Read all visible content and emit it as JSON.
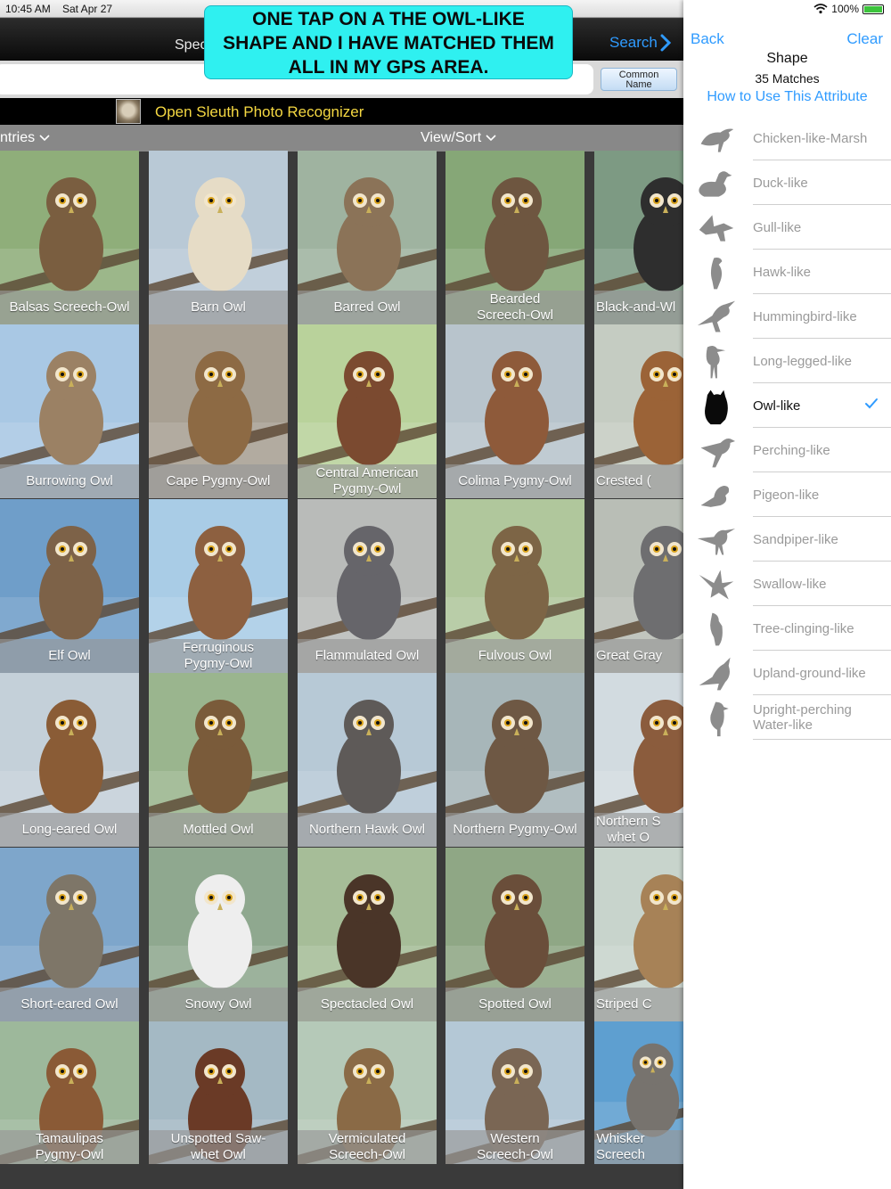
{
  "status": {
    "time": "10:45 AM",
    "date": "Sat Apr 27",
    "battery": "100%",
    "battery_level": 1.0
  },
  "nav": {
    "spec_partial": "Spec",
    "search_label": "Search"
  },
  "callout": {
    "line1": "ONE TAP ON A THE OWL-LIKE",
    "line2": "SHAPE AND I HAVE MATCHED THEM",
    "line3": "ALL IN MY GPS AREA."
  },
  "search": {
    "value": "",
    "placeholder": ""
  },
  "common_name_button": {
    "line1": "Common",
    "line2": "Name"
  },
  "sleuth": {
    "label": "Open Sleuth Photo Recognizer"
  },
  "filter": {
    "entries_label": "ntries",
    "viewsort_label": "View/Sort"
  },
  "owls": [
    {
      "name": "Balsas Screech-Owl",
      "bg": "#8fae7a",
      "body": "#7a5e40"
    },
    {
      "name": "Barn Owl",
      "bg": "#b9c9d6",
      "body": "#e6dcc6"
    },
    {
      "name": "Barred Owl",
      "bg": "#9fb3a0",
      "body": "#8b7358"
    },
    {
      "name": "Bearded\nScreech-Owl",
      "bg": "#86a777",
      "body": "#6e5640"
    },
    {
      "name": "Black-and-Wl",
      "bg": "#7d9a83",
      "body": "#2e2e2e"
    },
    {
      "name": "Burrowing Owl",
      "bg": "#a9c8e4",
      "body": "#9b8164"
    },
    {
      "name": "Cape Pygmy-Owl",
      "bg": "#a8a093",
      "body": "#8d6a44"
    },
    {
      "name": "Central American\nPygmy-Owl",
      "bg": "#b9d29b",
      "body": "#7b4a30"
    },
    {
      "name": "Colima Pygmy-Owl",
      "bg": "#b8c4cc",
      "body": "#8e5a3a"
    },
    {
      "name": "Crested (",
      "bg": "#c5ccc2",
      "body": "#9b6337"
    },
    {
      "name": "Elf Owl",
      "bg": "#6f9ec9",
      "body": "#7d6248"
    },
    {
      "name": "Ferruginous\nPygmy-Owl",
      "bg": "#a9cce6",
      "body": "#8d6040"
    },
    {
      "name": "Flammulated Owl",
      "bg": "#b9bbb9",
      "body": "#66656a"
    },
    {
      "name": "Fulvous Owl",
      "bg": "#b0c79c",
      "body": "#7d6546"
    },
    {
      "name": "Great Gray",
      "bg": "#b9beb6",
      "body": "#6e6e70"
    },
    {
      "name": "Long-eared Owl",
      "bg": "#c4d0d9",
      "body": "#8a5c36"
    },
    {
      "name": "Mottled Owl",
      "bg": "#9ab58e",
      "body": "#7a5b3a"
    },
    {
      "name": "Northern Hawk Owl",
      "bg": "#b7c9d6",
      "body": "#5e5a58"
    },
    {
      "name": "Northern Pygmy-Owl",
      "bg": "#a7b6b9",
      "body": "#6e5844"
    },
    {
      "name": "Northern S\nwhet O",
      "bg": "#d2dbe0",
      "body": "#8b5c3d"
    },
    {
      "name": "Short-eared Owl",
      "bg": "#7ea6cb",
      "body": "#7e7668"
    },
    {
      "name": "Snowy Owl",
      "bg": "#8fa88f",
      "body": "#eeeeee"
    },
    {
      "name": "Spectacled Owl",
      "bg": "#a6bd98",
      "body": "#4a3528"
    },
    {
      "name": "Spotted Owl",
      "bg": "#8fa785",
      "body": "#6a4e3a"
    },
    {
      "name": "Striped C",
      "bg": "#c8d4cc",
      "body": "#a78257"
    },
    {
      "name": "Tamaulipas\nPygmy-Owl",
      "bg": "#9db89b",
      "body": "#8a5a36"
    },
    {
      "name": "Unspotted Saw-\nwhet Owl",
      "bg": "#a4b9c4",
      "body": "#6a3a26"
    },
    {
      "name": "Vermiculated\nScreech-Owl",
      "bg": "#b5c9b8",
      "body": "#8a6a46"
    },
    {
      "name": "Western\nScreech-Owl",
      "bg": "#b4c8d6",
      "body": "#7a6654"
    },
    {
      "name": "Whisker\nScreech",
      "bg": "#5e9fd0",
      "body": "#77736e"
    }
  ],
  "panel": {
    "back_label": "Back",
    "clear_label": "Clear",
    "title": "Shape",
    "matches": "35 Matches",
    "howto": "How to Use This Attribute",
    "shapes": [
      {
        "label": "Chicken-like-Marsh",
        "icon": "chicken-marsh-silhouette-icon",
        "selected": false
      },
      {
        "label": "Duck-like",
        "icon": "duck-silhouette-icon",
        "selected": false
      },
      {
        "label": "Gull-like",
        "icon": "gull-silhouette-icon",
        "selected": false
      },
      {
        "label": "Hawk-like",
        "icon": "hawk-silhouette-icon",
        "selected": false
      },
      {
        "label": "Hummingbird-like",
        "icon": "hummingbird-silhouette-icon",
        "selected": false
      },
      {
        "label": "Long-legged-like",
        "icon": "long-legged-silhouette-icon",
        "selected": false
      },
      {
        "label": "Owl-like",
        "icon": "owl-silhouette-icon",
        "selected": true
      },
      {
        "label": "Perching-like",
        "icon": "perching-silhouette-icon",
        "selected": false
      },
      {
        "label": "Pigeon-like",
        "icon": "pigeon-silhouette-icon",
        "selected": false
      },
      {
        "label": "Sandpiper-like",
        "icon": "sandpiper-silhouette-icon",
        "selected": false
      },
      {
        "label": "Swallow-like",
        "icon": "swallow-silhouette-icon",
        "selected": false
      },
      {
        "label": "Tree-clinging-like",
        "icon": "tree-clinging-silhouette-icon",
        "selected": false
      },
      {
        "label": "Upland-ground-like",
        "icon": "upland-ground-silhouette-icon",
        "selected": false
      },
      {
        "label": "Upright-perching\nWater-like",
        "icon": "upright-perching-water-silhouette-icon",
        "selected": false
      }
    ]
  },
  "colors": {
    "accent": "#2f9bff",
    "callout": "#2ff0f0",
    "sleuth_text": "#f5d842",
    "check": "#2f9bff"
  }
}
